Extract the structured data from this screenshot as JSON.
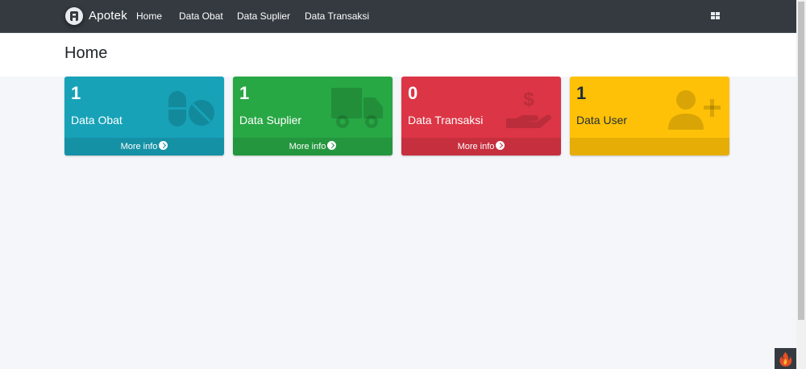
{
  "navbar": {
    "brand": "Apotek",
    "links": [
      "Home",
      "Data Obat",
      "Data Suplier",
      "Data Transaksi"
    ]
  },
  "page": {
    "title": "Home"
  },
  "cards": [
    {
      "count": "1",
      "label": "Data Obat",
      "footer": "More info",
      "color": "#17a2b8",
      "icon": "pills-icon"
    },
    {
      "count": "1",
      "label": "Data Suplier",
      "footer": "More info",
      "color": "#28a745",
      "icon": "truck-icon"
    },
    {
      "count": "0",
      "label": "Data Transaksi",
      "footer": "More info",
      "color": "#dc3545",
      "icon": "hand-dollar-icon"
    },
    {
      "count": "1",
      "label": "Data User",
      "footer": "",
      "color": "#ffc107",
      "icon": "user-plus-icon"
    }
  ]
}
